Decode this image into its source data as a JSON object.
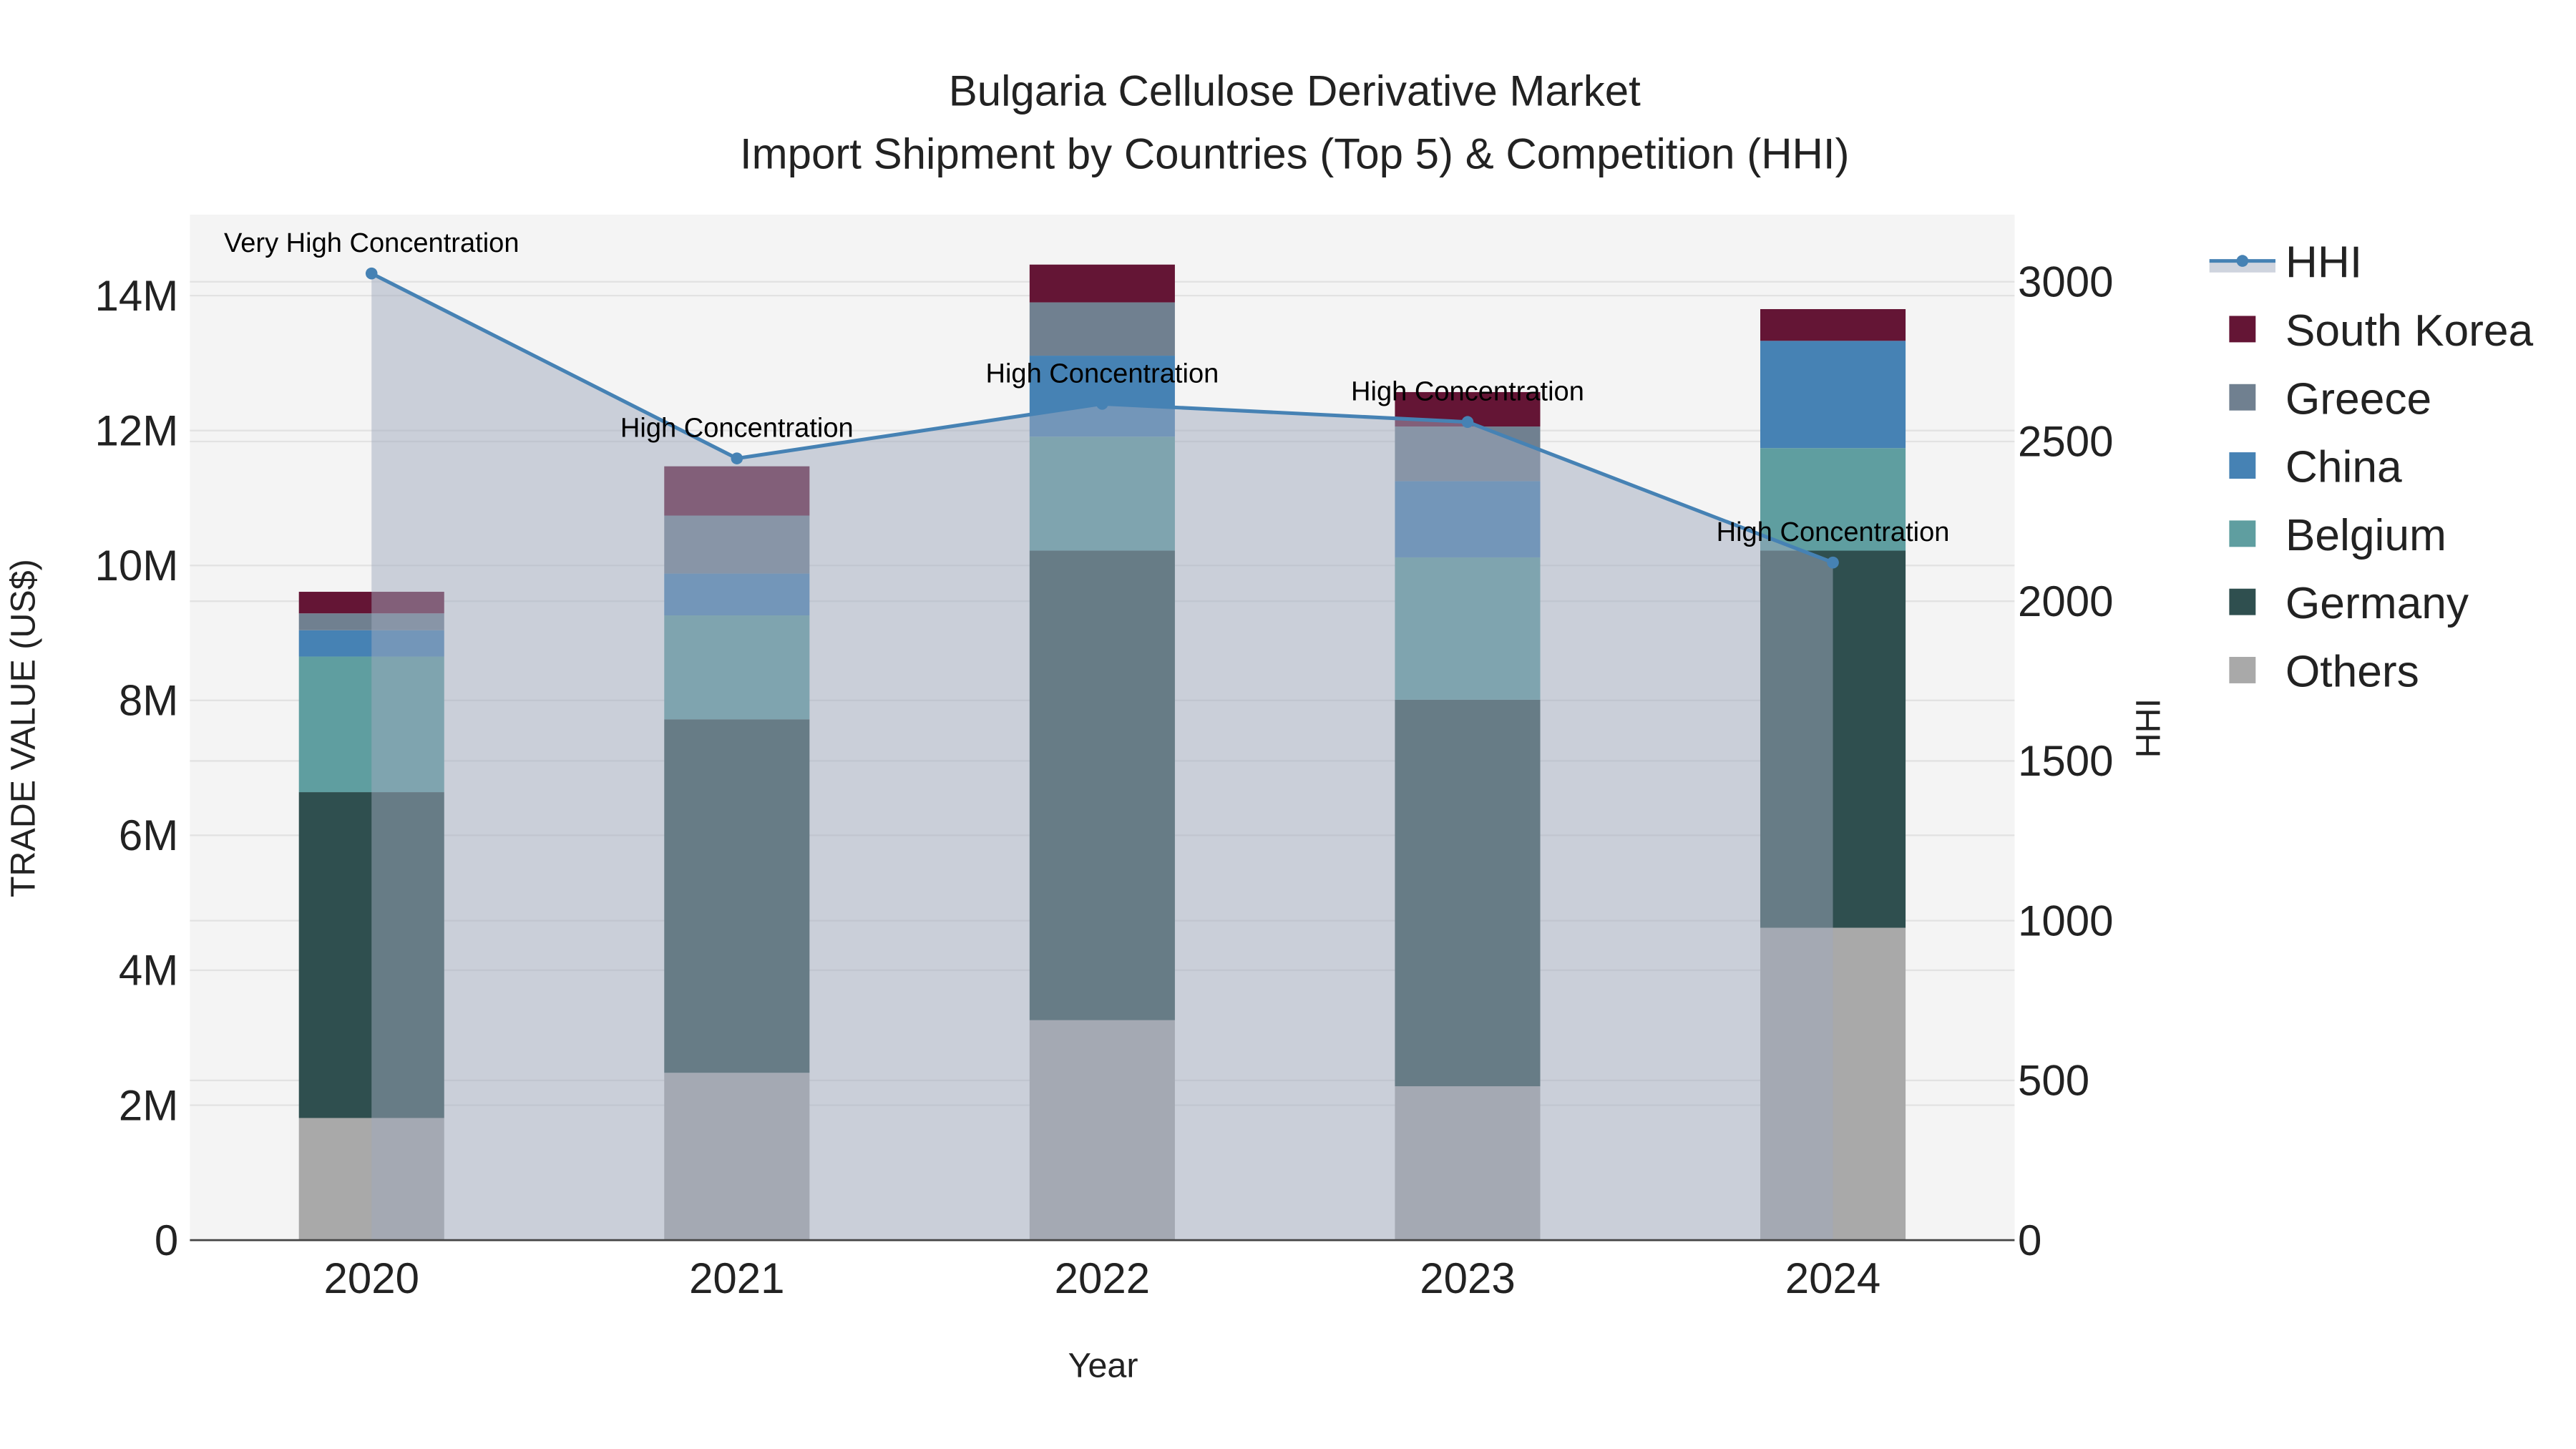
{
  "chart_data": {
    "type": "bar",
    "stacked": true,
    "title": "Bulgaria Cellulose Derivative Market",
    "subtitle": "Import Shipment by Countries (Top 5) & Competition (HHI)",
    "xlabel": "Year",
    "ylabel": "TRADE VALUE (US$)",
    "y2label": "HHI",
    "categories": [
      "2020",
      "2021",
      "2022",
      "2023",
      "2024"
    ],
    "ylim": [
      0,
      15200000
    ],
    "y_ticks": [
      0,
      2000000,
      4000000,
      6000000,
      8000000,
      10000000,
      12000000,
      14000000
    ],
    "y_tick_labels": [
      "0",
      "2M",
      "4M",
      "6M",
      "8M",
      "10M",
      "12M",
      "14M"
    ],
    "y2lim": [
      0,
      3210
    ],
    "y2_ticks": [
      0,
      500,
      1000,
      1500,
      2000,
      2500,
      3000
    ],
    "y2_tick_labels": [
      "0",
      "500",
      "1000",
      "1500",
      "2000",
      "2500",
      "3000"
    ],
    "grid": true,
    "legend_position": "right",
    "series": [
      {
        "name": "Others",
        "color": "#A9A9A9",
        "values": [
          1810000,
          2480000,
          3260000,
          2280000,
          4630000
        ]
      },
      {
        "name": "Germany",
        "color": "#2F4F4F",
        "values": [
          4830000,
          5240000,
          6960000,
          5730000,
          5590000
        ]
      },
      {
        "name": "Belgium",
        "color": "#5F9EA0",
        "values": [
          2010000,
          1540000,
          1690000,
          2110000,
          1520000
        ]
      },
      {
        "name": "China",
        "color": "#4682B4",
        "values": [
          390000,
          620000,
          1200000,
          1130000,
          1590000
        ]
      },
      {
        "name": "Greece",
        "color": "#708090",
        "values": [
          250000,
          860000,
          790000,
          810000,
          0
        ]
      },
      {
        "name": "South Korea",
        "color": "#641535",
        "values": [
          320000,
          730000,
          560000,
          510000,
          470000
        ]
      }
    ],
    "hhi": {
      "name": "HHI",
      "color": "#4682B4",
      "values": [
        3026,
        2447,
        2618,
        2561,
        2121
      ],
      "annotations": [
        "Very High Concentration",
        "High Concentration",
        "High Concentration",
        "High Concentration",
        "High Concentration"
      ]
    },
    "legend_order": [
      "HHI",
      "South Korea",
      "Greece",
      "China",
      "Belgium",
      "Germany",
      "Others"
    ]
  }
}
